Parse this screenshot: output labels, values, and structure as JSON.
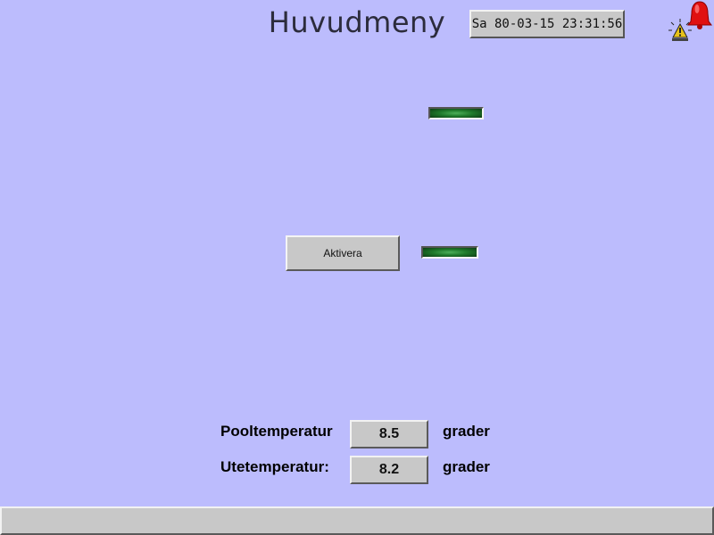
{
  "header": {
    "title": "Huvudmeny",
    "datetime": "Sa 80-03-15 23:31:56"
  },
  "icons": {
    "warning": "warning-light-icon",
    "alarm": "alarm-bell-icon"
  },
  "controls": {
    "activate_label": "Aktivera"
  },
  "indicators": {
    "led_top_state": "on",
    "led_activate_state": "on",
    "led_color": "#2e8b3d"
  },
  "temperatures": {
    "pool_label": "Pooltemperatur",
    "pool_value": "8.5",
    "pool_unit": "grader",
    "outdoor_label": "Utetemperatur:",
    "outdoor_value": "8.2",
    "outdoor_unit": "grader"
  },
  "statusbar": {
    "text": ""
  },
  "colors": {
    "background": "#bcbcfd",
    "panel": "#c8c8c8",
    "alarm_red": "#e01010"
  }
}
